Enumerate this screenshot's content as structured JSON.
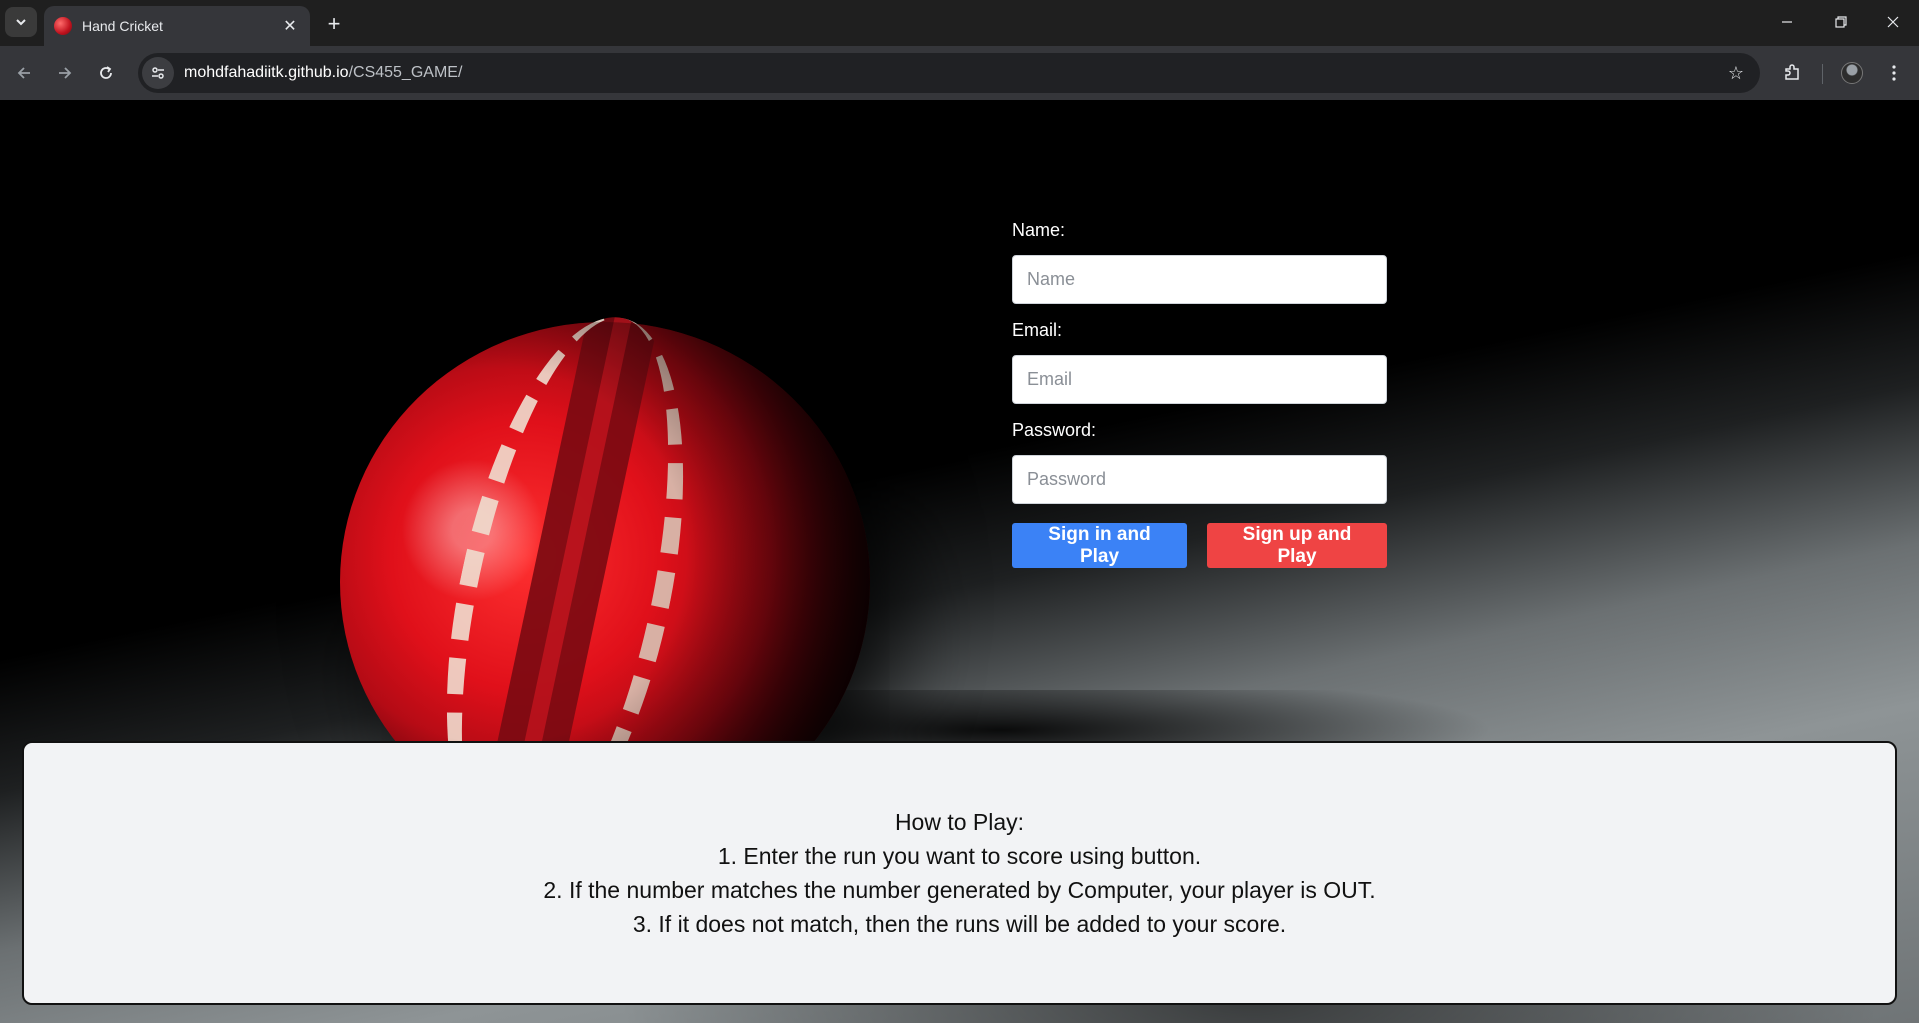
{
  "browser": {
    "tab_title": "Hand Cricket",
    "url_host": "mohdfahadiitk.github.io",
    "url_path": "/CS455_GAME/"
  },
  "form": {
    "name_label": "Name:",
    "name_placeholder": "Name",
    "email_label": "Email:",
    "email_placeholder": "Email",
    "password_label": "Password:",
    "password_placeholder": "Password",
    "signin_button": "Sign in and Play",
    "signup_button": "Sign up and Play"
  },
  "howto": {
    "title": "How to Play:",
    "steps": [
      "1. Enter the run you want to score using button.",
      "2. If the number matches the number generated by Computer, your player is OUT.",
      "3. If it does not match, then the runs will be added to your score."
    ]
  },
  "colors": {
    "signin": "#3b82f6",
    "signup": "#ef4444",
    "howto_bg": "#f2f3f5"
  }
}
